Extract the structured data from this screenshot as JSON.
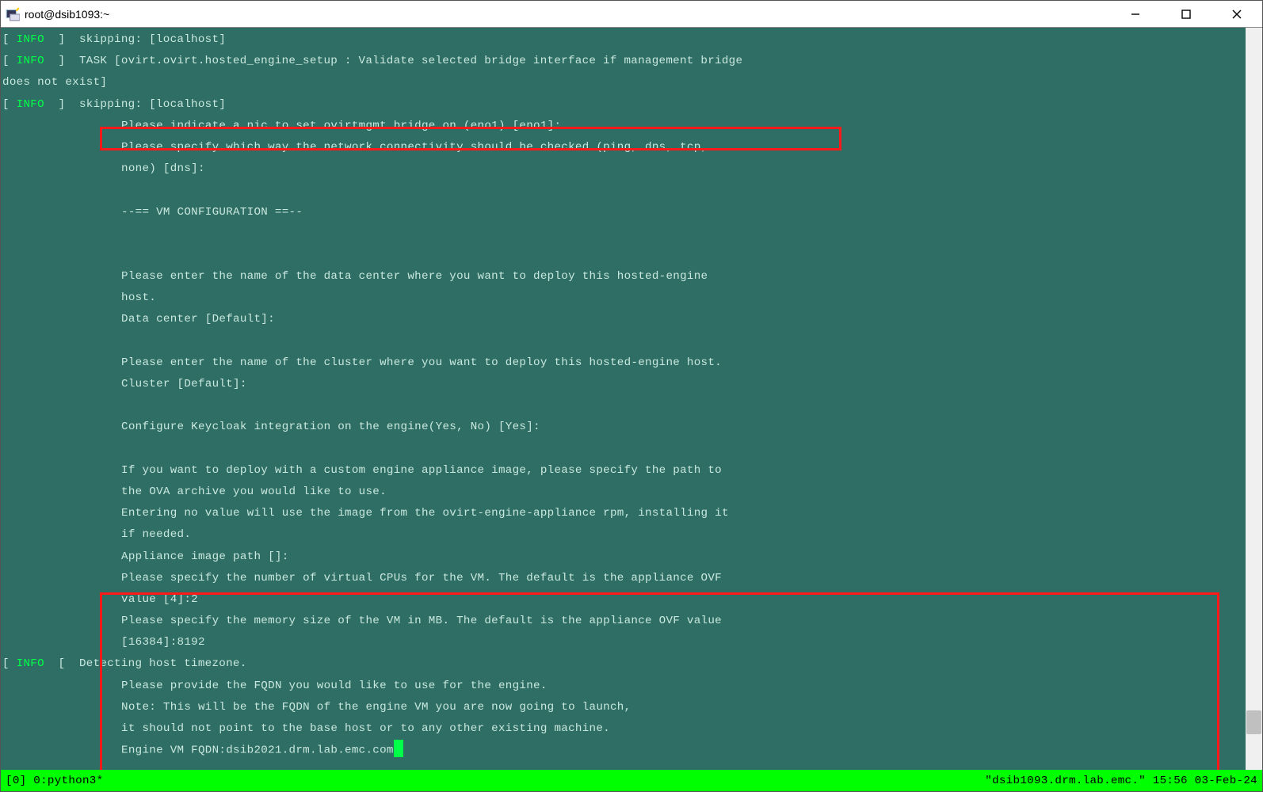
{
  "window": {
    "title": "root@dsib1093:~"
  },
  "info_tag": "INFO",
  "lines": {
    "l1": "skipping: [localhost]",
    "l2a": "TASK [ovirt.ovirt.hosted_engine_setup : Validate selected bridge interface if management bridge ",
    "l2b": "does not exist]",
    "l3": "skipping: [localhost]",
    "l_nic": "Please indicate a nic to set ovirtmgmt bridge on (eno1) [eno1]:",
    "l_net1": "Please specify which way the network connectivity should be checked (ping, dns, tcp, ",
    "l_net2": "none) [dns]:",
    "l_vmconf": "--== VM CONFIGURATION ==--",
    "l_dc1": "Please enter the name of the data center where you want to deploy this hosted-engine ",
    "l_dc2": "host.",
    "l_dc3": "Data center [Default]:",
    "l_cl1": "Please enter the name of the cluster where you want to deploy this hosted-engine host.",
    "l_cl2": "Cluster [Default]:",
    "l_kc": "Configure Keycloak integration on the engine(Yes, No) [Yes]:",
    "l_ova1": "If you want to deploy with a custom engine appliance image, please specify the path to ",
    "l_ova2": "the OVA archive you would like to use.",
    "l_ova3": "Entering no value will use the image from the ovirt-engine-appliance rpm, installing it ",
    "l_ova4": "if needed.",
    "l_ova5": "Appliance image path []:",
    "l_cpu1": "Please specify the number of virtual CPUs for the VM. The default is the appliance OVF ",
    "l_cpu2": "value [4]:2",
    "l_mem1": "Please specify the memory size of the VM in MB. The default is the appliance OVF value ",
    "l_mem2": "[16384]:8192",
    "l_tz": "Detecting host timezone.",
    "l_fq1": "Please provide the FQDN you would like to use for the engine.",
    "l_fq2": "Note: This will be the FQDN of the engine VM you are now going to launch,",
    "l_fq3": "it should not point to the base host or to any other existing machine.",
    "l_fq4": "Engine VM FQDN:dsib2021.drm.lab.emc.com"
  },
  "status": {
    "left": "[0] 0:python3*",
    "right": "\"dsib1093.drm.lab.emc.\" 15:56 03-Feb-24"
  }
}
